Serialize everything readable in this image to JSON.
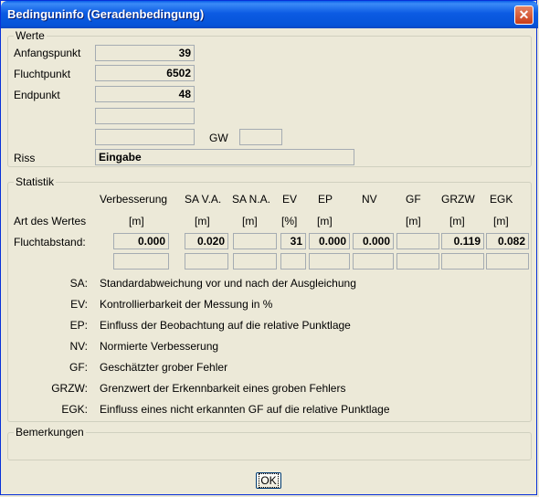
{
  "window": {
    "title": "Bedinguninfo (Geradenbedingung)",
    "close_icon": "close-icon"
  },
  "werte": {
    "legend": "Werte",
    "anfangspunkt_label": "Anfangspunkt",
    "anfangspunkt_value": "39",
    "fluchtpunkt_label": "Fluchtpunkt",
    "fluchtpunkt_value": "6502",
    "endpunkt_label": "Endpunkt",
    "endpunkt_value": "48",
    "extra1_value": "",
    "extra2_value": "",
    "gw_label": "GW",
    "gw_value": "",
    "riss_label": "Riss",
    "riss_value": "Eingabe"
  },
  "statistik": {
    "legend": "Statistik",
    "headers": [
      "Verbesserung",
      "SA V.A.",
      "SA N.A.",
      "EV",
      "EP",
      "NV",
      "GF",
      "GRZW",
      "EGK"
    ],
    "units_label": "Art des Wertes",
    "units": [
      "[m]",
      "[m]",
      "[m]",
      "[%]",
      "[m]",
      "",
      "[m]",
      "[m]",
      "[m]"
    ],
    "row_label": "Fluchtabstand:",
    "row_values": [
      "0.000",
      "0.020",
      "",
      "31",
      "0.000",
      "0.000",
      "",
      "0.119",
      "0.082"
    ],
    "row2_values": [
      "",
      "",
      "",
      "",
      "",
      "",
      "",
      "",
      ""
    ],
    "legend_items": [
      {
        "key": "SA:",
        "text": "Standardabweichung vor und nach der Ausgleichung"
      },
      {
        "key": "EV:",
        "text": "Kontrollierbarkeit der Messung in %"
      },
      {
        "key": "EP:",
        "text": "Einfluss der Beobachtung auf die relative Punktlage"
      },
      {
        "key": "NV:",
        "text": "Normierte Verbesserung"
      },
      {
        "key": "GF:",
        "text": "Geschätzter grober Fehler"
      },
      {
        "key": "GRZW:",
        "text": "Grenzwert der Erkennbarkeit eines groben Fehlers"
      },
      {
        "key": "EGK:",
        "text": "Einfluss eines nicht erkannten GF auf die relative Punktlage"
      }
    ]
  },
  "bemerkungen": {
    "legend": "Bemerkungen",
    "value": ""
  },
  "buttons": {
    "ok_label": "OK"
  }
}
